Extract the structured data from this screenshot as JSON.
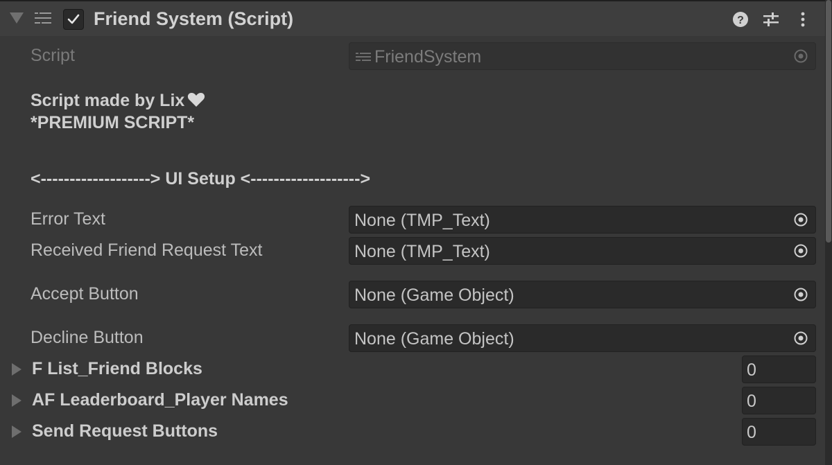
{
  "component": {
    "title": "Friend System (Script)",
    "enabled": true,
    "header_icons": [
      "help-icon",
      "presets-icon",
      "more-options-icon"
    ]
  },
  "script_field": {
    "label": "Script",
    "value": "FriendSystem"
  },
  "info": {
    "line1": "Script made by Lix",
    "line2": "*PREMIUM SCRIPT*",
    "header": "<-------------------> UI Setup <------------------->"
  },
  "fields": [
    {
      "label": "Error Text",
      "value": "None (TMP_Text)"
    },
    {
      "label": "Received Friend Request Text",
      "value": "None (TMP_Text)"
    },
    {
      "label": "Accept Button",
      "value": "None (Game Object)"
    },
    {
      "label": "Decline Button",
      "value": "None (Game Object)"
    }
  ],
  "lists": [
    {
      "label": "F List_Friend Blocks",
      "size": "0"
    },
    {
      "label": "AF Leaderboard_Player Names",
      "size": "0"
    },
    {
      "label": "Send Request Buttons",
      "size": "0"
    }
  ],
  "colors": {
    "panel_bg": "#383838",
    "field_bg": "#2a2a2a",
    "text": "#c4c4c4"
  }
}
